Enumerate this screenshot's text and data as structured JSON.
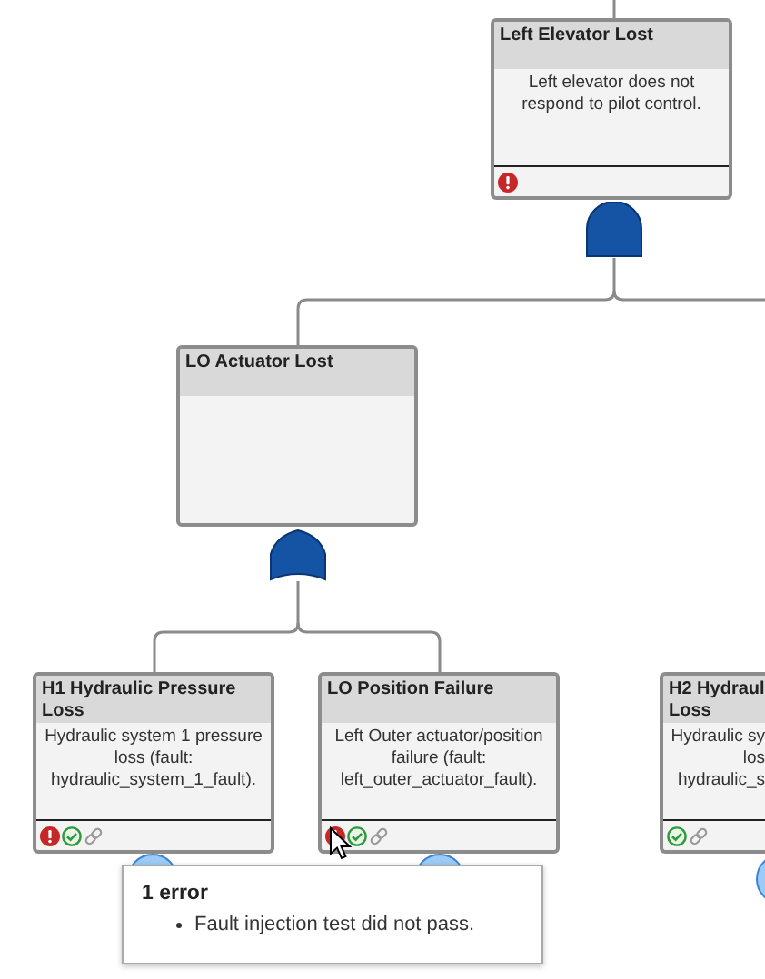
{
  "nodes": [
    {
      "title": "Left Elevator Lost",
      "description": "Left elevator does not respond to pilot control.",
      "indicators": [
        {
          "kind": "error"
        }
      ]
    },
    {
      "title": "LO Actuator Lost"
    },
    {
      "title": "H1 Hydraulic Pressure Loss",
      "description": "Hydraulic system 1 pressure loss (fault: hydraulic_system_1_fault).",
      "indicators": [
        {
          "kind": "error"
        },
        {
          "kind": "passed"
        },
        {
          "kind": "link"
        }
      ]
    },
    {
      "title": "LO Position Failure",
      "description": "Left Outer actuator/position failure (fault: left_outer_actuator_fault).",
      "indicators": [
        {
          "kind": "error"
        },
        {
          "kind": "passed"
        },
        {
          "kind": "link"
        }
      ]
    },
    {
      "title": "H2 Hydrauli\nLoss",
      "description": "Hydraulic sy\nlos\nhydraulic_s",
      "indicators": [
        {
          "kind": "passed"
        },
        {
          "kind": "link"
        }
      ]
    }
  ],
  "gates": [
    {
      "kind": "and"
    },
    {
      "kind": "or"
    }
  ],
  "tooltip": {
    "title": "1 error",
    "items": [
      "Fault injection test did not pass."
    ]
  }
}
